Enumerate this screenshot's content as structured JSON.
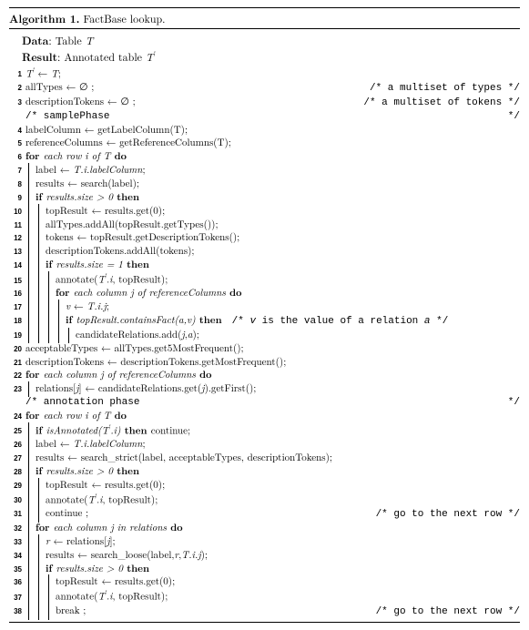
{
  "title_prefix": "Algorithm 1.",
  "title_text": "FactBase lookup.",
  "header_data_label": "Data",
  "header_data_val": ": Table ",
  "header_data_var": "T",
  "header_result_label": "Result",
  "header_result_val": ": Annotated table ",
  "header_result_var": "T",
  "header_result_sup": "′",
  "comments": {
    "c2": "/* a multiset of types */",
    "c3": "/* a multiset of tokens */",
    "cSample": "/* samplePhase",
    "cSampleEnd": "*/",
    "c18a": "/* ",
    "c18_v": "v",
    "c18_mid": " is the value of a relation ",
    "c18_a": "a",
    "c18b": " */",
    "cAnn": "/* annotation phase",
    "cAnnEnd": "*/",
    "c31": "/* go to the next row */",
    "c38": "/* go to the next row */"
  },
  "L": {
    "l1": "T′ ← T;",
    "l2": "allTypes ← ∅ ;",
    "l3": "descriptionTokens ← ∅ ;",
    "l4": "labelColumn ← getLabelColumn(T);",
    "l5": "referenceColumns ← getReferenceColumns(T);",
    "l6_for": "for ",
    "l6_it": "each row i of T",
    "l6_do": " do",
    "l7": "label ← T.i.labelColumn;",
    "l8": "results ← search(label);",
    "l9_if": "if ",
    "l9_it": "results.size > 0",
    "l9_then": " then",
    "l10": "topResult ← results.get(0);",
    "l11": "allTypes.addAll(topResult.getTypes());",
    "l12": "tokens ← topResult.getDescriptionTokens();",
    "l13": "descriptionTokens.addAll(tokens);",
    "l14_if": "if ",
    "l14_it": "results.size = 1",
    "l14_then": " then",
    "l15": "annotate(T′.i, topResult);",
    "l16_for": "for ",
    "l16_it": "each column j of referenceColumns",
    "l16_do": " do",
    "l17": "v ← T.i.j;",
    "l18_if": "if ",
    "l18_it": "topResult.containsFact(a,v)",
    "l18_then": " then",
    "l19": "candidateRelations.add(j,a);",
    "l20": "acceptableTypes ← allTypes.get5MostFrequent();",
    "l21": "descriptionTokens ← descriptionTokens.getMostFrequent();",
    "l22_for": "for ",
    "l22_it": "each column j of referenceColumns",
    "l22_do": " do",
    "l23": "relations[j] ← candidateRelations.get(j).getFirst();",
    "l24_for": "for ",
    "l24_it": "each row i of T",
    "l24_do": " do",
    "l25_if": "if ",
    "l25_it": "isAnnotated(T′.i)",
    "l25_then": " then ",
    "l25_cont": "continue;",
    "l26": "label ← T.i.labelColumn;",
    "l27": "results ← search_strict(label, acceptableTypes, descriptionTokens);",
    "l28_if": "if ",
    "l28_it": "results.size > 0",
    "l28_then": " then",
    "l29": "topResult ← results.get(0);",
    "l30": "annotate(T′.i, topResult);",
    "l31": "continue ;",
    "l32_for": "for ",
    "l32_it": "each column j in relations",
    "l32_do": " do",
    "l33": "r ← relations[j];",
    "l34": "results ← search_loose(label,r,T.i.j);",
    "l35_if": "if ",
    "l35_it": "results.size > 0",
    "l35_then": " then",
    "l36": "topResult ← results.get(0);",
    "l37": "annotate(T′.i, topResult);",
    "l38": "break ;"
  }
}
